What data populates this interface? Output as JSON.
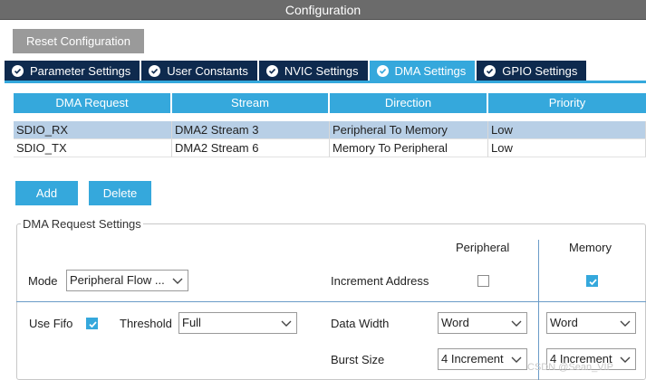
{
  "window": {
    "title": "Configuration"
  },
  "toolbar": {
    "reset_label": "Reset Configuration"
  },
  "tabs": [
    {
      "label": "Parameter Settings",
      "active": false
    },
    {
      "label": "User Constants",
      "active": false
    },
    {
      "label": "NVIC Settings",
      "active": false
    },
    {
      "label": "DMA Settings",
      "active": true
    },
    {
      "label": "GPIO Settings",
      "active": false
    }
  ],
  "dma_table": {
    "headers": [
      "DMA Request",
      "Stream",
      "Direction",
      "Priority"
    ],
    "rows": [
      {
        "request": "SDIO_RX",
        "stream": "DMA2 Stream 3",
        "direction": "Peripheral To Memory",
        "priority": "Low",
        "selected": true
      },
      {
        "request": "SDIO_TX",
        "stream": "DMA2 Stream 6",
        "direction": "Memory To Peripheral",
        "priority": "Low",
        "selected": false
      }
    ]
  },
  "actions": {
    "add_label": "Add",
    "delete_label": "Delete"
  },
  "settings": {
    "legend": "DMA Request Settings",
    "peripheral_header": "Peripheral",
    "memory_header": "Memory",
    "mode_label": "Mode",
    "mode_value": "Peripheral Flow ...",
    "increment_label": "Increment Address",
    "increment_peripheral": false,
    "increment_memory": true,
    "use_fifo_label": "Use Fifo",
    "use_fifo": true,
    "threshold_label": "Threshold",
    "threshold_value": "Full",
    "data_width_label": "Data Width",
    "data_width_peripheral": "Word",
    "data_width_memory": "Word",
    "burst_size_label": "Burst Size",
    "burst_size_peripheral": "4 Increment",
    "burst_size_memory": "4 Increment"
  },
  "watermark": "CSDN @Sean_VIP",
  "colors": {
    "accent": "#35a8dc",
    "tab_dark": "#0e2a4e",
    "titlebar": "#6b6b6b",
    "selected_row": "#b8cfe6"
  }
}
